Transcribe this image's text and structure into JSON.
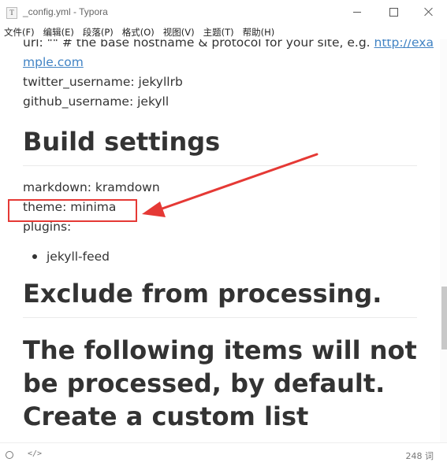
{
  "window": {
    "icon_glyph": "T",
    "title": "_config.yml - Typora",
    "controls": [
      "minimize-icon",
      "maximize-icon",
      "close-icon"
    ]
  },
  "menu": {
    "items": [
      "文件(F)",
      "编辑(E)",
      "段落(P)",
      "格式(O)",
      "视图(V)",
      "主题(T)",
      "帮助(H)"
    ]
  },
  "document": {
    "url_line_prefix": "url: \"\" # the base hostname & protocol for your site, e.g. ",
    "url_link_part1": "http://exa",
    "url_link_part2": "mple.com",
    "twitter_line": "twitter_username: jekyllrb",
    "github_line": "github_username:  jekyll",
    "heading_build": "Build settings",
    "markdown_line": "markdown: kramdown",
    "theme_line": "theme: minima",
    "plugins_line": "plugins:",
    "plugin_items": [
      "jekyll-feed"
    ],
    "heading_exclude": "Exclude from processing.",
    "heading_following_1": "The following items will not",
    "heading_following_2": "be processed, by default.",
    "heading_following_3": "Create a custom list"
  },
  "status": {
    "source_toggle": "</>",
    "word_count": "248 词"
  },
  "annotation": {
    "color": "#e53935"
  }
}
